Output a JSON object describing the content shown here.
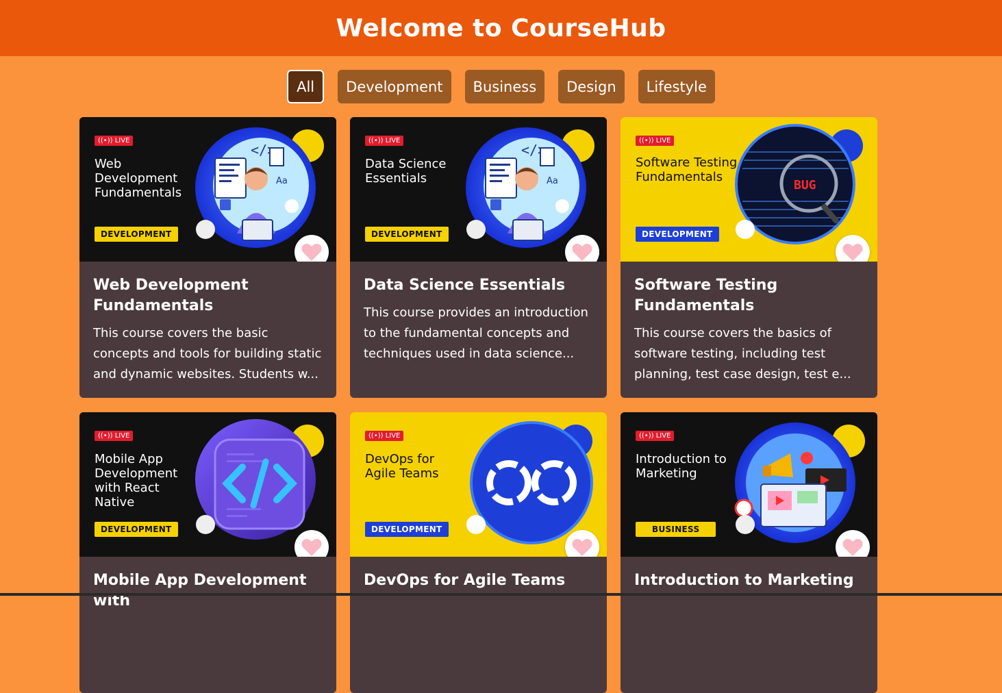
{
  "header": {
    "title": "Welcome to CourseHub"
  },
  "filters": [
    {
      "label": "All",
      "active": true
    },
    {
      "label": "Development",
      "active": false
    },
    {
      "label": "Business",
      "active": false
    },
    {
      "label": "Design",
      "active": false
    },
    {
      "label": "Lifestyle",
      "active": false
    }
  ],
  "live_label": "LIVE",
  "courses": [
    {
      "banner_title": "Web Development Fundamentals",
      "category": "DEVELOPMENT",
      "title": "Web Development Fundamentals",
      "description": "This course covers the basic concepts and tools for building static and dynamic websites. Students w...",
      "banner_style": "dark",
      "art": "developer-laptop"
    },
    {
      "banner_title": "Data Science Essentials",
      "category": "DEVELOPMENT",
      "title": "Data Science Essentials",
      "description": "This course provides an introduction to the fundamental concepts and techniques used in data science...",
      "banner_style": "dark",
      "art": "developer-laptop"
    },
    {
      "banner_title": "Software Testing Fundamentals",
      "category": "DEVELOPMENT",
      "title": "Software Testing Fundamentals",
      "description": "This course covers the basics of software testing, including test planning, test case design, test e...",
      "banner_style": "yellow",
      "art": "bug-magnifier",
      "art_text": "BUG"
    },
    {
      "banner_title": "Mobile App Development with React Native",
      "category": "DEVELOPMENT",
      "title": "Mobile App Development with",
      "description": "",
      "banner_style": "dark",
      "art": "code-brackets"
    },
    {
      "banner_title": "DevOps for Agile Teams",
      "category": "DEVELOPMENT",
      "title": "DevOps for Agile Teams",
      "description": "",
      "banner_style": "yellow",
      "art": "infinity-loop"
    },
    {
      "banner_title": "Introduction to Marketing",
      "category": "BUSINESS",
      "title": "Introduction to Marketing",
      "description": "",
      "banner_style": "dark",
      "art": "megaphone-marketing"
    }
  ],
  "colors": {
    "page_bg": "#fb923c",
    "header_bg": "#ea580c",
    "filter_bg": "#9a5a24",
    "card_bg": "#4b3a3d",
    "badge_yellow": "#f5d100",
    "badge_blue": "#1d3fd8",
    "heart": "#f9b8c4"
  }
}
